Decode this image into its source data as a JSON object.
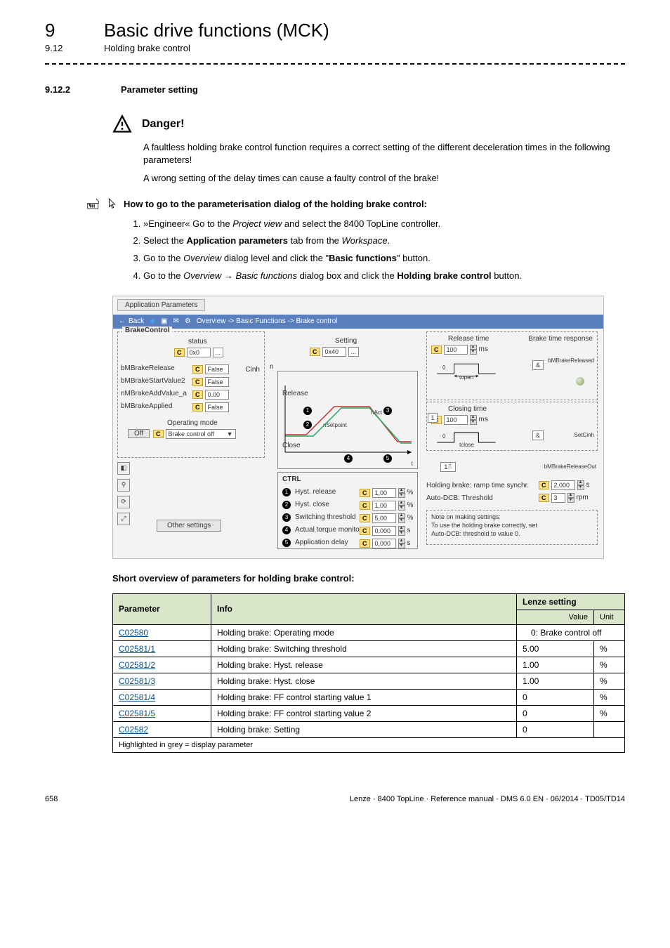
{
  "header": {
    "chapter_number": "9",
    "chapter_title": "Basic drive functions (MCK)",
    "subsection_number": "9.12",
    "subsection_title": "Holding brake control"
  },
  "section": {
    "number": "9.12.2",
    "title": "Parameter setting"
  },
  "danger": {
    "label": "Danger!",
    "p1": "A faultless holding brake control function requires a correct setting of the different deceleration times in the following parameters!",
    "p2": "A wrong setting of the delay times can cause a faulty control of the brake!"
  },
  "howto": {
    "title": "How to go to the parameterisation dialog of the holding brake control:",
    "steps": [
      {
        "pre": "»Engineer« Go to the ",
        "em1": "Project view",
        "mid": " and select the 8400 TopLine controller."
      },
      {
        "pre": "Select the ",
        "b1": "Application parameters",
        "mid": " tab from the ",
        "em1": "Workspace",
        "post": "."
      },
      {
        "pre": "Go to the ",
        "em1": "Overview",
        "mid": " dialog level and click the \"",
        "b1": "Basic functions",
        "post": "\" button."
      },
      {
        "pre": "Go to the ",
        "em1": "Overview",
        "arrow": " → ",
        "em2": "Basic functions",
        "mid": " dialog box and click the ",
        "b1": "Holding brake control",
        "post": " button."
      }
    ]
  },
  "screenshot": {
    "tab": "Application Parameters",
    "back": "Back",
    "path": "Overview -> Basic Functions -> Brake control",
    "brakecontrol_legend": "BrakeControl",
    "labels": {
      "status": "status",
      "setting": "Setting",
      "cinh": "Cinh",
      "release_time": "Release time",
      "closing_time": "Closing time",
      "brake_time_response": "Brake time response",
      "operating_mode": "Operating mode",
      "off_btn": "Off",
      "other_settings": "Other settings",
      "ctrl": "CTRL",
      "release": "Release",
      "close": "Close",
      "hyst_release": "Hyst. release",
      "hyst_close": "Hyst. close",
      "switching_threshold": "Switching threshold",
      "actual_torque": "Actual torque monitor..",
      "application_delay": "Application delay",
      "holding_ramp": "Holding brake: ramp time synchr.",
      "auto_dcb": "Auto-DCB: Threshold",
      "note_hdr": "Note on making settings:",
      "note_l1": "To use the holding brake correctly, set",
      "note_l2": "Auto-DCB: threshold to value 0.",
      "bMBrakeReleased": "bMBrakeReleased",
      "setcinh": "SetCinh",
      "bMBrakeReleaseOut": "bMBrakeReleaseOut",
      "topen": "topen",
      "tclose": "tclose",
      "nsetpoint": "nSetpoint",
      "nact": "nAct",
      "amp": "&",
      "one": "1",
      "zero": "0",
      "drop_brake_off": "Brake control off",
      "drop_arrow": "▼"
    },
    "ports": {
      "bMBrakeRelease": "bMBrakeRelease",
      "bMBrakeStartValue2": "bMBrakeStartValue2",
      "nMBrakeAddValue_a": "nMBrakeAddValue_a",
      "bMBrakeApplied": "bMBrakeApplied"
    },
    "values": {
      "status": "0x0",
      "setting": "0x40",
      "false": "False",
      "zero00": "0.00",
      "ms100a": "100",
      "ms100b": "100",
      "ms": "ms",
      "pct": "%",
      "s": "s",
      "rpm": "rpm",
      "hyst_release": "1,00",
      "hyst_close": "1,00",
      "switching": "5,00",
      "torque": "0,000",
      "appdelay": "0,000",
      "ramp": "2,000",
      "autodcb": "3"
    },
    "bullets": {
      "b1": "1",
      "b2": "2",
      "b3": "3",
      "b4": "4",
      "b5": "5"
    }
  },
  "overview_heading": "Short overview of parameters for holding brake control:",
  "table": {
    "head_parameter": "Parameter",
    "head_info": "Info",
    "head_lenze": "Lenze setting",
    "head_value": "Value",
    "head_unit": "Unit",
    "rows": [
      {
        "param": "C02580",
        "info": "Holding brake: Operating mode",
        "value": "0: Brake control off",
        "unit": ""
      },
      {
        "param": "C02581/1",
        "info": "Holding brake: Switching threshold",
        "value": "5.00",
        "unit": "%"
      },
      {
        "param": "C02581/2",
        "info": "Holding brake: Hyst. release",
        "value": "1.00",
        "unit": "%"
      },
      {
        "param": "C02581/3",
        "info": "Holding brake: Hyst. close",
        "value": "1.00",
        "unit": "%"
      },
      {
        "param": "C02581/4",
        "info": "Holding brake: FF control starting value 1",
        "value": "0",
        "unit": "%"
      },
      {
        "param": "C02581/5",
        "info": "Holding brake: FF control starting value 2",
        "value": "0",
        "unit": "%"
      },
      {
        "param": "C02582",
        "info": "Holding brake: Setting",
        "value": "0",
        "unit": ""
      }
    ],
    "footnote": "Highlighted in grey = display parameter"
  },
  "footer": {
    "page": "658",
    "credits": "Lenze · 8400 TopLine · Reference manual · DMS 6.0 EN · 06/2014 · TD05/TD14"
  }
}
